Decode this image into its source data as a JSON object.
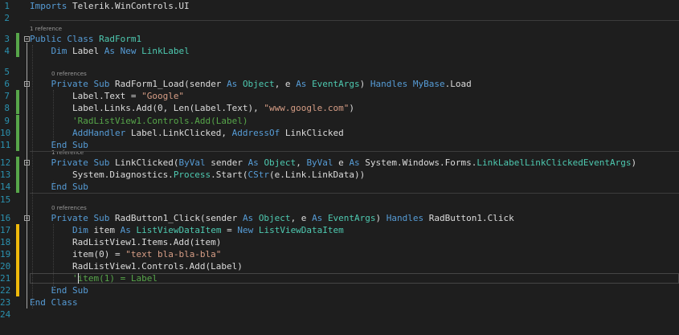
{
  "editor": {
    "lines": [
      {
        "n": "1",
        "tokens": [
          {
            "t": "Imports",
            "c": "kw"
          },
          {
            "t": " Telerik.WinControls.UI"
          }
        ]
      },
      {
        "n": "2",
        "tokens": []
      },
      {
        "n": "3",
        "lens": "1 reference",
        "tokens": [
          {
            "t": "Public Class",
            "c": "kw"
          },
          {
            "t": " "
          },
          {
            "t": "RadForm1",
            "c": "ty"
          }
        ]
      },
      {
        "n": "4",
        "tokens": [
          {
            "t": "    "
          },
          {
            "t": "Dim",
            "c": "kw"
          },
          {
            "t": " Label "
          },
          {
            "t": "As New",
            "c": "kw"
          },
          {
            "t": " "
          },
          {
            "t": "LinkLabel",
            "c": "ty"
          }
        ]
      },
      {
        "n": "5",
        "tokens": []
      },
      {
        "n": "6",
        "lens": "0 references",
        "tokens": [
          {
            "t": "    "
          },
          {
            "t": "Private Sub",
            "c": "kw"
          },
          {
            "t": " RadForm1_Load(sender "
          },
          {
            "t": "As",
            "c": "kw"
          },
          {
            "t": " "
          },
          {
            "t": "Object",
            "c": "ty"
          },
          {
            "t": ", e "
          },
          {
            "t": "As",
            "c": "kw"
          },
          {
            "t": " "
          },
          {
            "t": "EventArgs",
            "c": "ty"
          },
          {
            "t": ") "
          },
          {
            "t": "Handles",
            "c": "kw"
          },
          {
            "t": " "
          },
          {
            "t": "MyBase",
            "c": "kw"
          },
          {
            "t": ".Load"
          }
        ]
      },
      {
        "n": "7",
        "tokens": [
          {
            "t": "        Label.Text = "
          },
          {
            "t": "\"Google\"",
            "c": "str"
          }
        ]
      },
      {
        "n": "8",
        "tokens": [
          {
            "t": "        Label.Links.Add(0, Len(Label.Text), "
          },
          {
            "t": "\"www.google.com\"",
            "c": "str"
          },
          {
            "t": ")"
          }
        ]
      },
      {
        "n": "9",
        "tokens": [
          {
            "t": "        "
          },
          {
            "t": "'RadListView1.Controls.Add(Label)",
            "c": "cm"
          }
        ]
      },
      {
        "n": "10",
        "tokens": [
          {
            "t": "        "
          },
          {
            "t": "AddHandler",
            "c": "kw"
          },
          {
            "t": " Label.LinkClicked, "
          },
          {
            "t": "AddressOf",
            "c": "kw"
          },
          {
            "t": " LinkClicked"
          }
        ]
      },
      {
        "n": "11",
        "tokens": [
          {
            "t": "    "
          },
          {
            "t": "End Sub",
            "c": "kw"
          }
        ]
      },
      {
        "n": "12",
        "lens": "1 reference",
        "tokens": [
          {
            "t": "    "
          },
          {
            "t": "Private Sub",
            "c": "kw"
          },
          {
            "t": " LinkClicked("
          },
          {
            "t": "ByVal",
            "c": "kw"
          },
          {
            "t": " sender "
          },
          {
            "t": "As",
            "c": "kw"
          },
          {
            "t": " "
          },
          {
            "t": "Object",
            "c": "ty"
          },
          {
            "t": ", "
          },
          {
            "t": "ByVal",
            "c": "kw"
          },
          {
            "t": " e "
          },
          {
            "t": "As",
            "c": "kw"
          },
          {
            "t": " System.Windows.Forms."
          },
          {
            "t": "LinkLabelLinkClickedEventArgs",
            "c": "ty"
          },
          {
            "t": ")"
          }
        ]
      },
      {
        "n": "13",
        "tokens": [
          {
            "t": "        System.Diagnostics."
          },
          {
            "t": "Process",
            "c": "ty"
          },
          {
            "t": ".Start("
          },
          {
            "t": "CStr",
            "c": "kw"
          },
          {
            "t": "(e.Link.LinkData))"
          }
        ]
      },
      {
        "n": "14",
        "tokens": [
          {
            "t": "    "
          },
          {
            "t": "End Sub",
            "c": "kw"
          }
        ]
      },
      {
        "n": "15",
        "tokens": []
      },
      {
        "n": "16",
        "lens": "0 references",
        "tokens": [
          {
            "t": "    "
          },
          {
            "t": "Private Sub",
            "c": "kw"
          },
          {
            "t": " RadButton1_Click(sender "
          },
          {
            "t": "As",
            "c": "kw"
          },
          {
            "t": " "
          },
          {
            "t": "Object",
            "c": "ty"
          },
          {
            "t": ", e "
          },
          {
            "t": "As",
            "c": "kw"
          },
          {
            "t": " "
          },
          {
            "t": "EventArgs",
            "c": "ty"
          },
          {
            "t": ") "
          },
          {
            "t": "Handles",
            "c": "kw"
          },
          {
            "t": " RadButton1.Click"
          }
        ]
      },
      {
        "n": "17",
        "tokens": [
          {
            "t": "        "
          },
          {
            "t": "Dim",
            "c": "kw"
          },
          {
            "t": " item "
          },
          {
            "t": "As",
            "c": "kw"
          },
          {
            "t": " "
          },
          {
            "t": "ListViewDataItem",
            "c": "ty"
          },
          {
            "t": " = "
          },
          {
            "t": "New",
            "c": "kw"
          },
          {
            "t": " "
          },
          {
            "t": "ListViewDataItem",
            "c": "ty"
          }
        ]
      },
      {
        "n": "18",
        "tokens": [
          {
            "t": "        RadListView1.Items.Add(item)"
          }
        ]
      },
      {
        "n": "19",
        "tokens": [
          {
            "t": "        item(0) = "
          },
          {
            "t": "\"text bla-bla-bla\"",
            "c": "str"
          }
        ]
      },
      {
        "n": "20",
        "tokens": [
          {
            "t": "        RadListView1.Controls.Add(Label)"
          }
        ]
      },
      {
        "n": "21",
        "tokens": [
          {
            "t": "        "
          },
          {
            "t": "'item(1) = Label",
            "c": "cm"
          }
        ]
      },
      {
        "n": "22",
        "tokens": [
          {
            "t": "    "
          },
          {
            "t": "End Sub",
            "c": "kw"
          }
        ]
      },
      {
        "n": "23",
        "tokens": [
          {
            "t": "End Class",
            "c": "kw"
          }
        ]
      },
      {
        "n": "24",
        "tokens": []
      }
    ],
    "colors": {
      "background": "#1e1e1e",
      "keyword": "#569cd6",
      "type": "#4ec9b0",
      "string": "#d69d85",
      "comment": "#57a64a",
      "text": "#dcdcdc",
      "line_number": "#2b91af",
      "codelens": "#999999",
      "change_saved": "#57a64a",
      "change_unsaved": "#efb90b"
    }
  }
}
